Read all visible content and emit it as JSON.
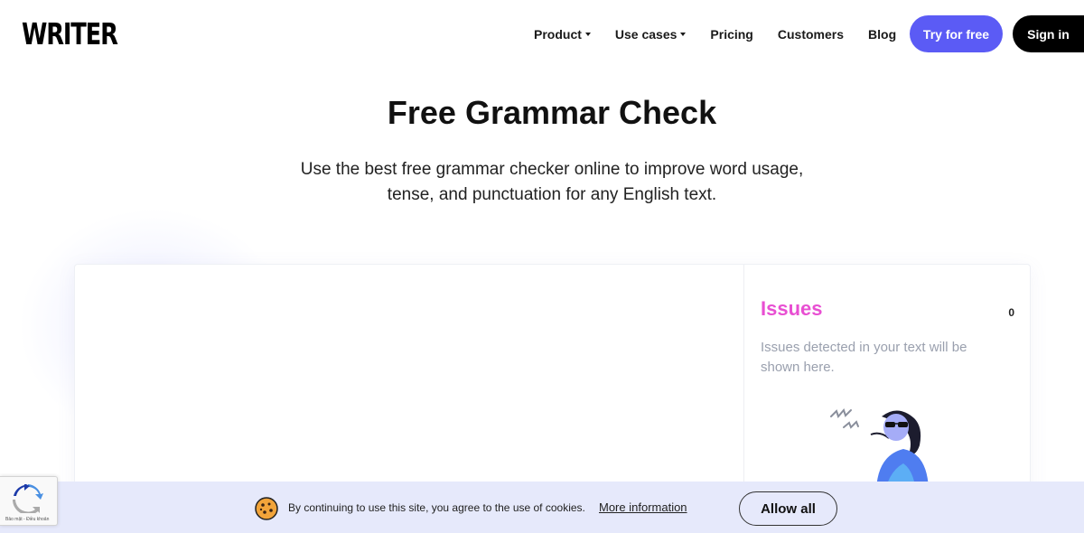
{
  "header": {
    "logo": "WRITER",
    "nav": [
      {
        "label": "Product",
        "has_dropdown": true
      },
      {
        "label": "Use cases",
        "has_dropdown": true
      },
      {
        "label": "Pricing",
        "has_dropdown": false
      },
      {
        "label": "Customers",
        "has_dropdown": false
      },
      {
        "label": "Blog",
        "has_dropdown": false
      }
    ],
    "try_button": "Try for free",
    "signin_button": "Sign in"
  },
  "hero": {
    "title": "Free Grammar Check",
    "subtitle_line1": "Use the best free grammar checker online to improve word usage,",
    "subtitle_line2": "tense, and punctuation for any English text."
  },
  "issues_panel": {
    "title": "Issues",
    "count": "0",
    "description": "Issues detected in your text will be shown here.",
    "illustration_icon": "person-with-sunglasses-illustration"
  },
  "cookie_bar": {
    "icon": "cookie-icon",
    "text": "By continuing to use this site, you agree to the use of cookies.",
    "link": "More information",
    "button": "Allow all"
  },
  "recaptcha": {
    "icon": "recaptcha-icon",
    "label": "Bảo mật - Điều khoản"
  },
  "colors": {
    "accent": "#5b5bf5",
    "issues_title": "#e84fd2",
    "cookie_bar_bg": "#e6e9fb"
  }
}
